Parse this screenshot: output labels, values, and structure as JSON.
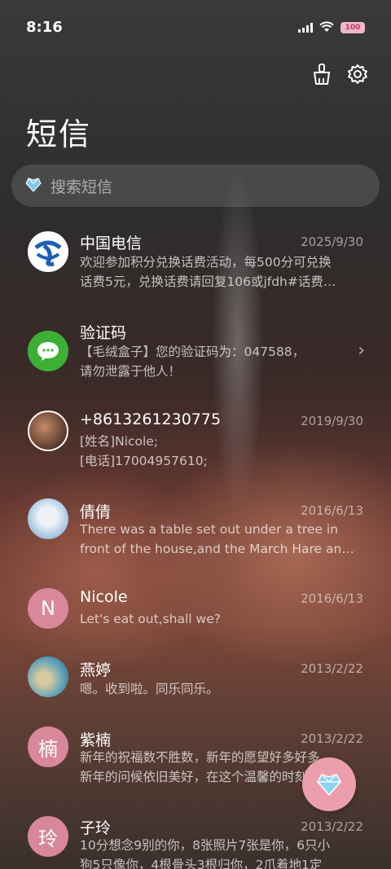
{
  "status_bar": {
    "time": "8:16",
    "battery": "100"
  },
  "header": {
    "title": "短信"
  },
  "search": {
    "placeholder": "搜索短信"
  },
  "colors": {
    "fab": "#ec9eac",
    "avatar_pink": "#d9879b",
    "wechat_green": "#3cb035",
    "telecom_blue": "#1a5fb4"
  },
  "messages": [
    {
      "name": "中国电信",
      "date": "2025/9/30",
      "line1": "欢迎参加积分兑换话费活动，每500分可兑换",
      "line2": "话费5元，兑换话费请回复106或jfdh#话费…",
      "avatar": "telecom-logo"
    },
    {
      "name": "验证码",
      "date": "",
      "line1": "【毛绒盒子】您的验证码为：047588，",
      "line2": "请勿泄露于他人！",
      "avatar": "chat-bubble-icon"
    },
    {
      "name": "+8613261230775",
      "date": "2019/9/30",
      "line1": "[姓名]Nicole;",
      "line2": "[电话]17004957610;",
      "avatar": "photo"
    },
    {
      "name": "倩倩",
      "date": "2016/6/13",
      "line1": "There was a table set out under a tree in",
      "line2": "front of the house,and the March Hare an…",
      "avatar": "photo"
    },
    {
      "name": "Nicole",
      "date": "2016/6/13",
      "line1": "Let's eat out,shall we?",
      "line2": "",
      "avatar_letter": "N"
    },
    {
      "name": "燕婷",
      "date": "2013/2/22",
      "line1": "嗯。收到啦。同乐同乐。",
      "line2": "",
      "avatar": "photo"
    },
    {
      "name": "紫楠",
      "date": "2013/2/22",
      "line1": "新年的祝福数不胜数，新年的愿望好多好多，",
      "line2": "新年的问候依旧美好，在这个温馨的时刻，…",
      "avatar_letter": "楠"
    },
    {
      "name": "子玲",
      "date": "2013/2/22",
      "line1": "10分想念9别的你，8张照片7张是你，6只小",
      "line2": "狗5只像你，4根骨头3根归你，2爪着地1定",
      "avatar_letter": "玲"
    }
  ]
}
